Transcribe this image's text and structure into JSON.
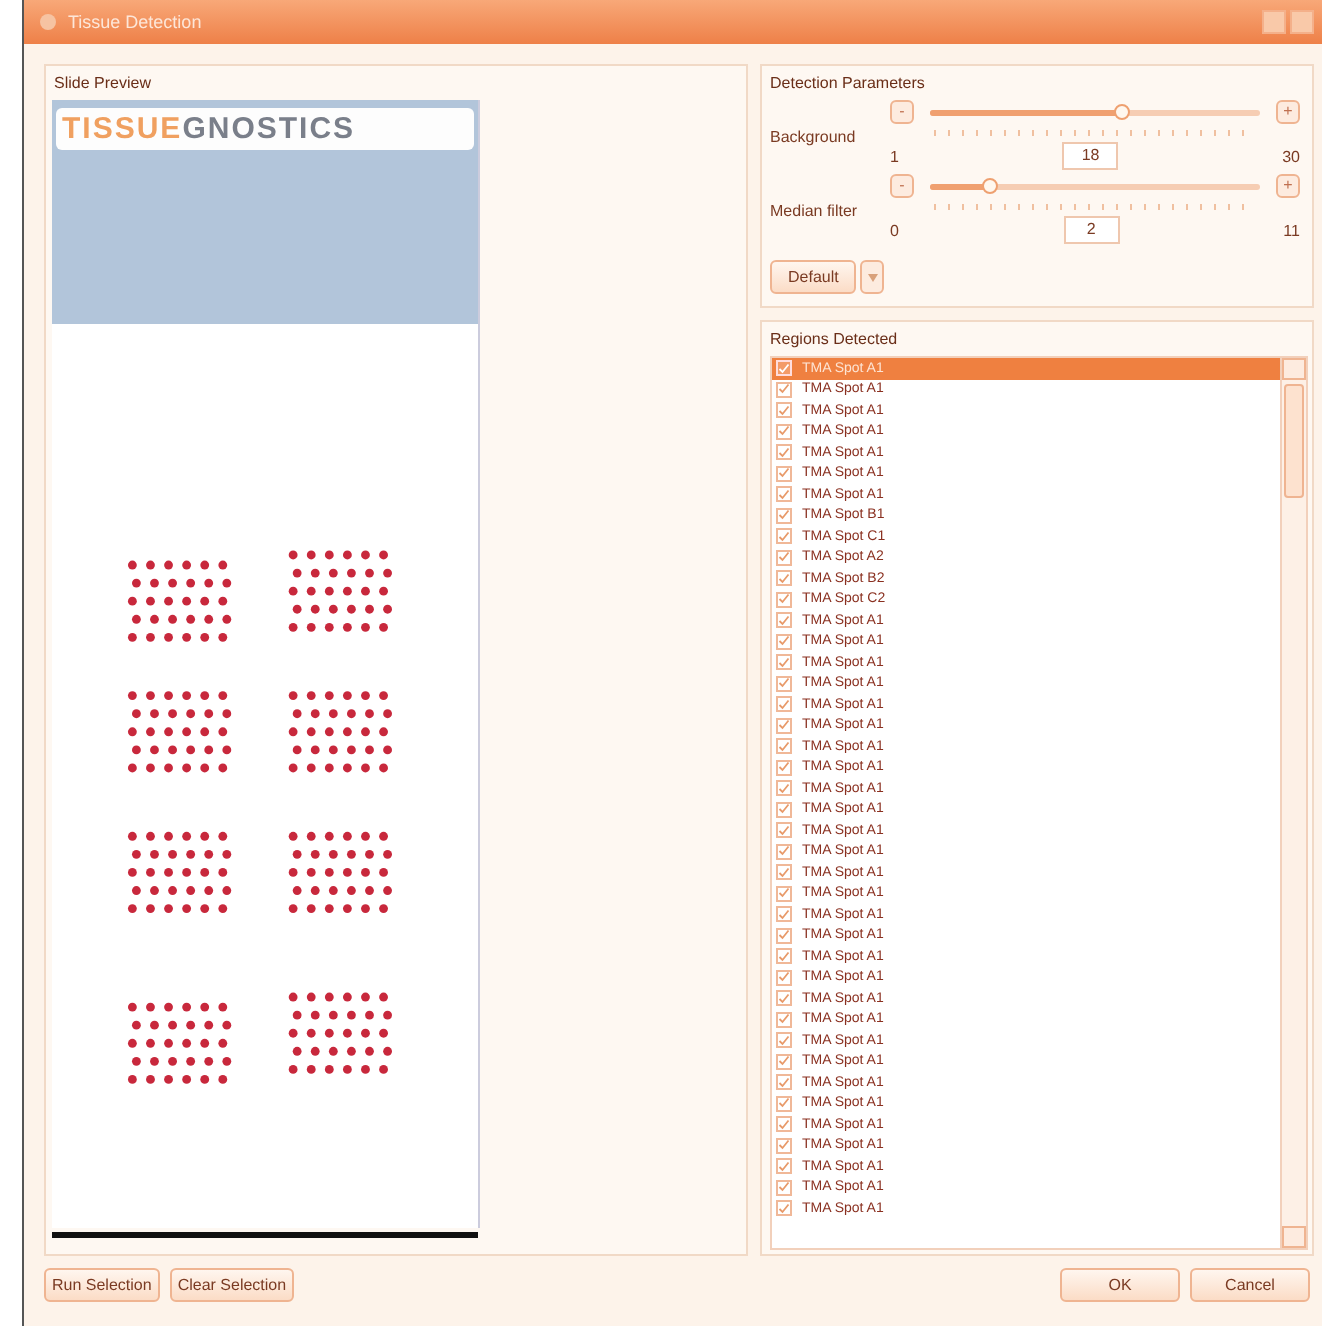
{
  "window": {
    "title": "Tissue Detection"
  },
  "slide_preview": {
    "title": "Slide Preview",
    "logo": [
      "TISSUE",
      "GNOSTICS"
    ]
  },
  "detection_parameters": {
    "title": "Detection Parameters",
    "sliders": [
      {
        "label": "Background",
        "minus": "-",
        "plus": "+",
        "min": "1",
        "value": "18",
        "max": "30",
        "level": 0.58
      },
      {
        "label": "Median filter",
        "minus": "-",
        "plus": "+",
        "min": "0",
        "value": "2",
        "max": "11",
        "level": 0.18
      }
    ],
    "default_button": "Default"
  },
  "regions": {
    "title": "Regions Detected",
    "items": [
      {
        "label": "TMA Spot A1",
        "checked": true,
        "selected": true
      },
      {
        "label": "TMA Spot A1",
        "checked": true,
        "selected": false
      },
      {
        "label": "TMA Spot A1",
        "checked": true,
        "selected": false
      },
      {
        "label": "TMA Spot A1",
        "checked": true,
        "selected": false
      },
      {
        "label": "TMA Spot A1",
        "checked": true,
        "selected": false
      },
      {
        "label": "TMA Spot A1",
        "checked": true,
        "selected": false
      },
      {
        "label": "TMA Spot A1",
        "checked": true,
        "selected": false
      },
      {
        "label": "TMA Spot B1",
        "checked": true,
        "selected": false
      },
      {
        "label": "TMA Spot C1",
        "checked": true,
        "selected": false
      },
      {
        "label": "TMA Spot A2",
        "checked": true,
        "selected": false
      },
      {
        "label": "TMA Spot B2",
        "checked": true,
        "selected": false
      },
      {
        "label": "TMA Spot C2",
        "checked": true,
        "selected": false
      },
      {
        "label": "TMA Spot A1",
        "checked": true,
        "selected": false
      },
      {
        "label": "TMA Spot A1",
        "checked": true,
        "selected": false
      },
      {
        "label": "TMA Spot A1",
        "checked": true,
        "selected": false
      },
      {
        "label": "TMA Spot A1",
        "checked": true,
        "selected": false
      },
      {
        "label": "TMA Spot A1",
        "checked": true,
        "selected": false
      },
      {
        "label": "TMA Spot A1",
        "checked": true,
        "selected": false
      },
      {
        "label": "TMA Spot A1",
        "checked": true,
        "selected": false
      },
      {
        "label": "TMA Spot A1",
        "checked": true,
        "selected": false
      },
      {
        "label": "TMA Spot A1",
        "checked": true,
        "selected": false
      },
      {
        "label": "TMA Spot A1",
        "checked": true,
        "selected": false
      },
      {
        "label": "TMA Spot A1",
        "checked": true,
        "selected": false
      },
      {
        "label": "TMA Spot A1",
        "checked": true,
        "selected": false
      },
      {
        "label": "TMA Spot A1",
        "checked": true,
        "selected": false
      },
      {
        "label": "TMA Spot A1",
        "checked": true,
        "selected": false
      },
      {
        "label": "TMA Spot A1",
        "checked": true,
        "selected": false
      },
      {
        "label": "TMA Spot A1",
        "checked": true,
        "selected": false
      },
      {
        "label": "TMA Spot A1",
        "checked": true,
        "selected": false
      },
      {
        "label": "TMA Spot A1",
        "checked": true,
        "selected": false
      },
      {
        "label": "TMA Spot A1",
        "checked": true,
        "selected": false
      },
      {
        "label": "TMA Spot A1",
        "checked": true,
        "selected": false
      },
      {
        "label": "TMA Spot A1",
        "checked": true,
        "selected": false
      },
      {
        "label": "TMA Spot A1",
        "checked": true,
        "selected": false
      },
      {
        "label": "TMA Spot A1",
        "checked": true,
        "selected": false
      },
      {
        "label": "TMA Spot A1",
        "checked": true,
        "selected": false
      },
      {
        "label": "TMA Spot A1",
        "checked": true,
        "selected": false
      },
      {
        "label": "TMA Spot A1",
        "checked": true,
        "selected": false
      },
      {
        "label": "TMA Spot A1",
        "checked": true,
        "selected": false
      },
      {
        "label": "TMA Spot A1",
        "checked": true,
        "selected": false
      },
      {
        "label": "TMA Spot A1",
        "checked": true,
        "selected": false
      }
    ]
  },
  "left_buttons": [
    "Run Selection",
    "Clear Selection"
  ],
  "right_buttons": [
    "OK",
    "Cancel"
  ]
}
